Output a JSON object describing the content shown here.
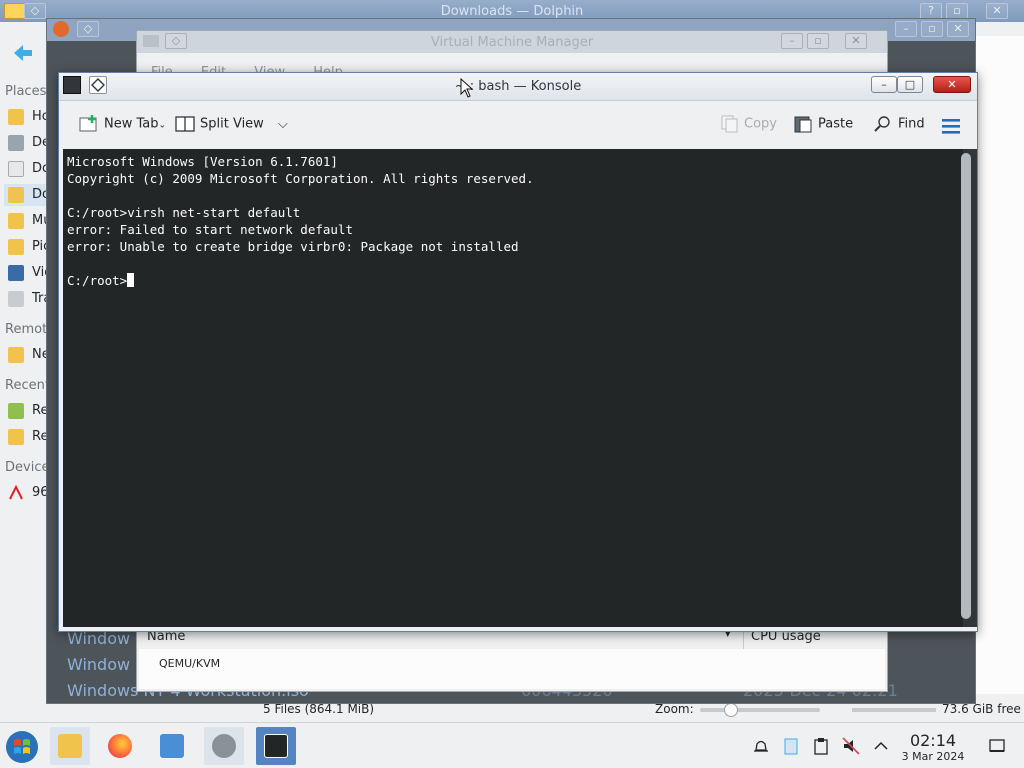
{
  "dolphin": {
    "title": "Downloads — Dolphin",
    "places_header": "Places",
    "remote_header": "Remote",
    "recent_header": "Recent",
    "devices_header": "Devices",
    "places": [
      "Ho",
      "De",
      "Do",
      "Do",
      "Mu",
      "Pic",
      "Vid",
      "Tra"
    ],
    "remote": [
      "Ne"
    ],
    "recent": [
      "Re",
      "Re"
    ],
    "devices": [
      "96"
    ],
    "status_files": "5 Files (864.1 MiB)",
    "zoom_label": "Zoom:",
    "free_space": "73.6 GiB free"
  },
  "firefox_window": {
    "file_rows": [
      "Window",
      "Window",
      "Windows NT 4 Workstation.iso"
    ],
    "size_value": "606443520",
    "date_value": "2023-Dec-24 02:21"
  },
  "vmm": {
    "title": "Virtual Machine Manager",
    "menu": [
      "File",
      "Edit",
      "View",
      "Help"
    ],
    "col_name": "Name",
    "col_cpu": "CPU usage",
    "row_connection": "QEMU/KVM"
  },
  "konsole": {
    "title": "~ : bash — Konsole",
    "toolbar": {
      "new_tab": "New Tab",
      "split_view": "Split View",
      "copy": "Copy",
      "paste": "Paste",
      "find": "Find"
    },
    "terminal_lines": [
      "Microsoft Windows [Version 6.1.7601]",
      "Copyright (c) 2009 Microsoft Corporation. All rights reserved.",
      "",
      "C:/root>virsh net-start default",
      "error: Failed to start network default",
      "error: Unable to create bridge virbr0: Package not installed",
      ""
    ],
    "prompt": "C:/root>"
  },
  "taskbar": {
    "time": "02:14",
    "date": "3 Mar 2024",
    "apps": [
      "file-manager",
      "firefox",
      "virt-manager-settings",
      "virt-manager",
      "konsole"
    ]
  },
  "colors": {
    "terminal_bg": "#232627",
    "terminal_fg": "#fcfcfc",
    "accent": "#3daee9"
  }
}
